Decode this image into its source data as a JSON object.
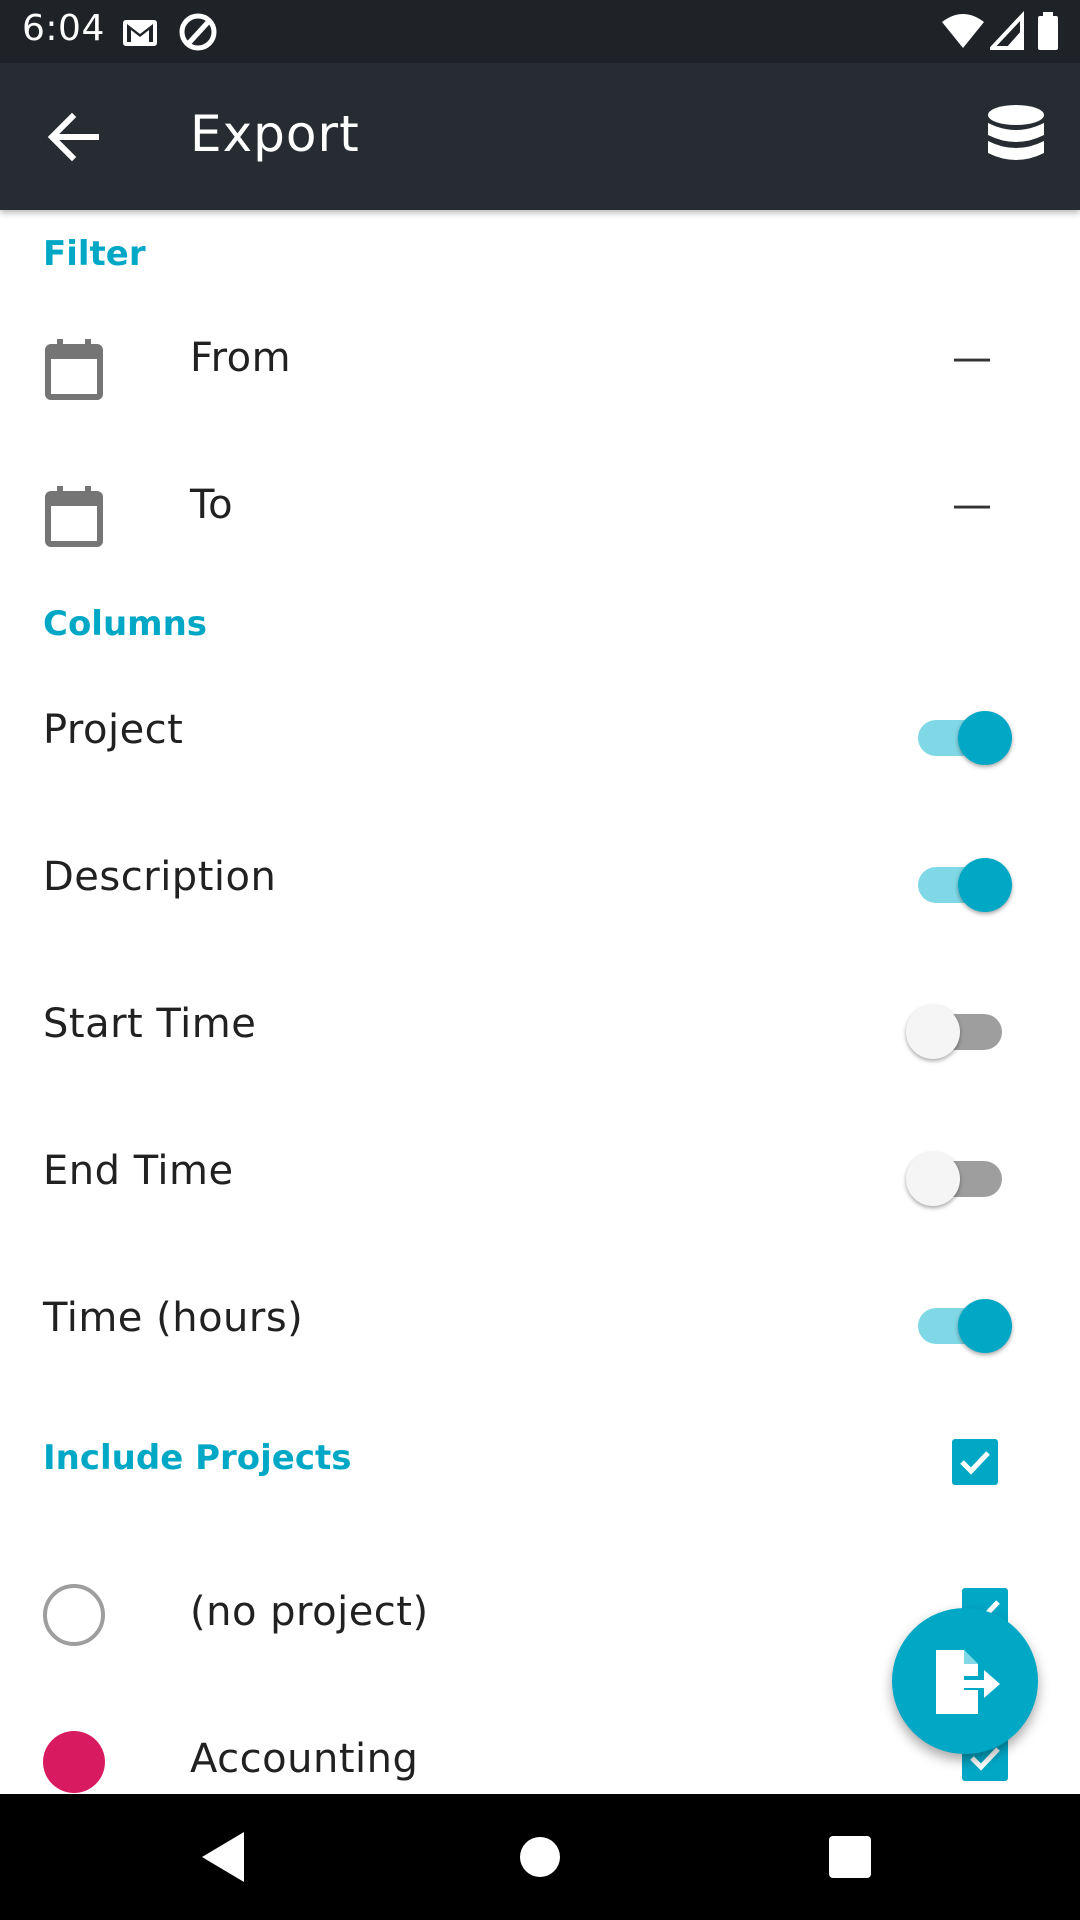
{
  "status_bar": {
    "time": "6:04",
    "left_icons": [
      "gmail-icon",
      "at-sign-icon"
    ],
    "right_icons": [
      "wifi-icon",
      "signal-icon",
      "battery-icon"
    ]
  },
  "app_bar": {
    "title": "Export",
    "back_icon": "arrow-back-icon",
    "action_icon": "database-icon"
  },
  "filter": {
    "header": "Filter",
    "from_label": "From",
    "from_value": "—",
    "to_label": "To",
    "to_value": "—"
  },
  "columns": {
    "header": "Columns",
    "items": [
      {
        "label": "Project",
        "enabled": true
      },
      {
        "label": "Description",
        "enabled": true
      },
      {
        "label": "Start Time",
        "enabled": false
      },
      {
        "label": "End Time",
        "enabled": false
      },
      {
        "label": "Time (hours)",
        "enabled": true
      }
    ]
  },
  "include_projects": {
    "header": "Include Projects",
    "all_checked": true,
    "projects": [
      {
        "name": "(no project)",
        "color": "none",
        "checked": true
      },
      {
        "name": "Accounting",
        "color": "#d81b60",
        "checked": true
      }
    ]
  },
  "fab": {
    "icon": "export-file-icon"
  },
  "colors": {
    "accent": "#00a8c6",
    "app_bar": "#262c32",
    "status_bar": "#1f2328"
  }
}
